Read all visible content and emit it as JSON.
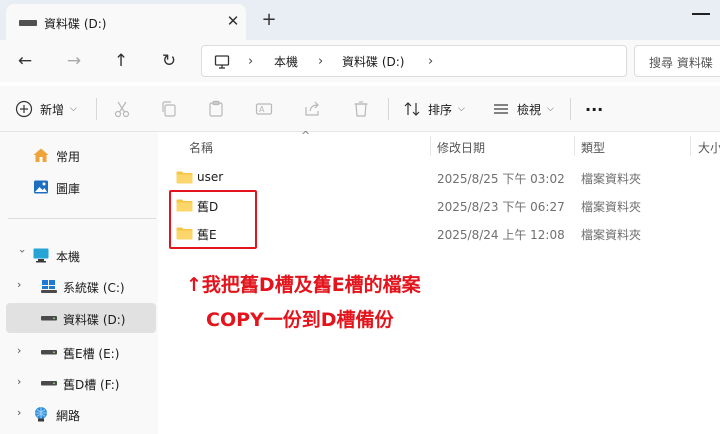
{
  "tab": {
    "title": "資料碟 (D:)"
  },
  "breadcrumb": [
    "本機",
    "資料碟 (D:)"
  ],
  "search": {
    "placeholder": "搜尋 資料碟"
  },
  "toolbar": {
    "new_label": "新增",
    "sort_label": "排序",
    "view_label": "檢視",
    "more_label": "..."
  },
  "sidebar": {
    "items": [
      {
        "label": "常用",
        "icon": "home-icon"
      },
      {
        "label": "圖庫",
        "icon": "gallery-icon"
      },
      {
        "label": "本機",
        "icon": "pc-icon"
      },
      {
        "label": "系統碟 (C:)",
        "icon": "windows-drive-icon"
      },
      {
        "label": "資料碟 (D:)",
        "icon": "drive-icon",
        "selected": true
      },
      {
        "label": "舊E槽 (E:)",
        "icon": "drive-icon"
      },
      {
        "label": "舊D槽 (F:)",
        "icon": "drive-icon"
      },
      {
        "label": "網路",
        "icon": "network-icon"
      }
    ]
  },
  "columns": [
    "名稱",
    "修改日期",
    "類型",
    "大小"
  ],
  "files": [
    {
      "name": "user",
      "modified": "2025/8/25 下午 03:02",
      "type": "檔案資料夾"
    },
    {
      "name": "舊D",
      "modified": "2025/8/23 下午 06:27",
      "type": "檔案資料夾"
    },
    {
      "name": "舊E",
      "modified": "2025/8/24 上午 12:08",
      "type": "檔案資料夾"
    }
  ],
  "annotation": {
    "line1": "↑我把舊D槽及舊E槽的檔案",
    "line2": "COPY一份到D槽備份",
    "color": "#e3141c"
  },
  "colors": {
    "accent": "#0067c0",
    "folder": "#f6c544",
    "annotation": "#e3141c"
  }
}
